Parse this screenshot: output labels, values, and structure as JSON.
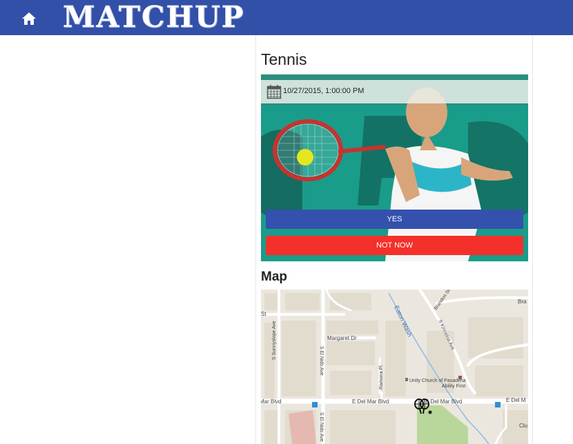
{
  "app": {
    "logo_text": "MATCHUP",
    "brand_color": "#3350a8"
  },
  "nav": {
    "home_icon": "home-icon"
  },
  "event": {
    "sport": "Tennis",
    "datetime": "10/27/2015, 1:00:00 PM",
    "calendar_icon": "calendar-icon",
    "yes_label": "YES",
    "not_now_label": "NOT NOW",
    "yes_color": "#3451ad",
    "not_now_color": "#f3312a"
  },
  "map": {
    "title": "Map",
    "labels": {
      "eaton_wash": "Eaton Wash",
      "brandon_st": "Brandon St",
      "s_kinneloa_ave": "S Kinneloa Ave",
      "margaret_dr": "Margaret Dr",
      "s_sunnyslope_ave": "S Sunnyslope Ave",
      "s_el_nido_ave": "S El Nido Ave",
      "s_el_nido_ave_2": "S El Nido Ave",
      "ramona_pl": "Ramona Pl",
      "unity_church": "Unity Church of Pasadena",
      "ability_first": "Ability First",
      "mar_blvd": "Mar Blvd",
      "e_del_mar_blvd_1": "E Del Mar Blvd",
      "e_del_mar_blvd_2": "E Del Mar Blvd",
      "e_del_mar_blvd_3": "E Del M",
      "st": "St",
      "bra": "Bra",
      "club": "Clu"
    },
    "marker_icon": "tennis-racket-marker-icon"
  }
}
